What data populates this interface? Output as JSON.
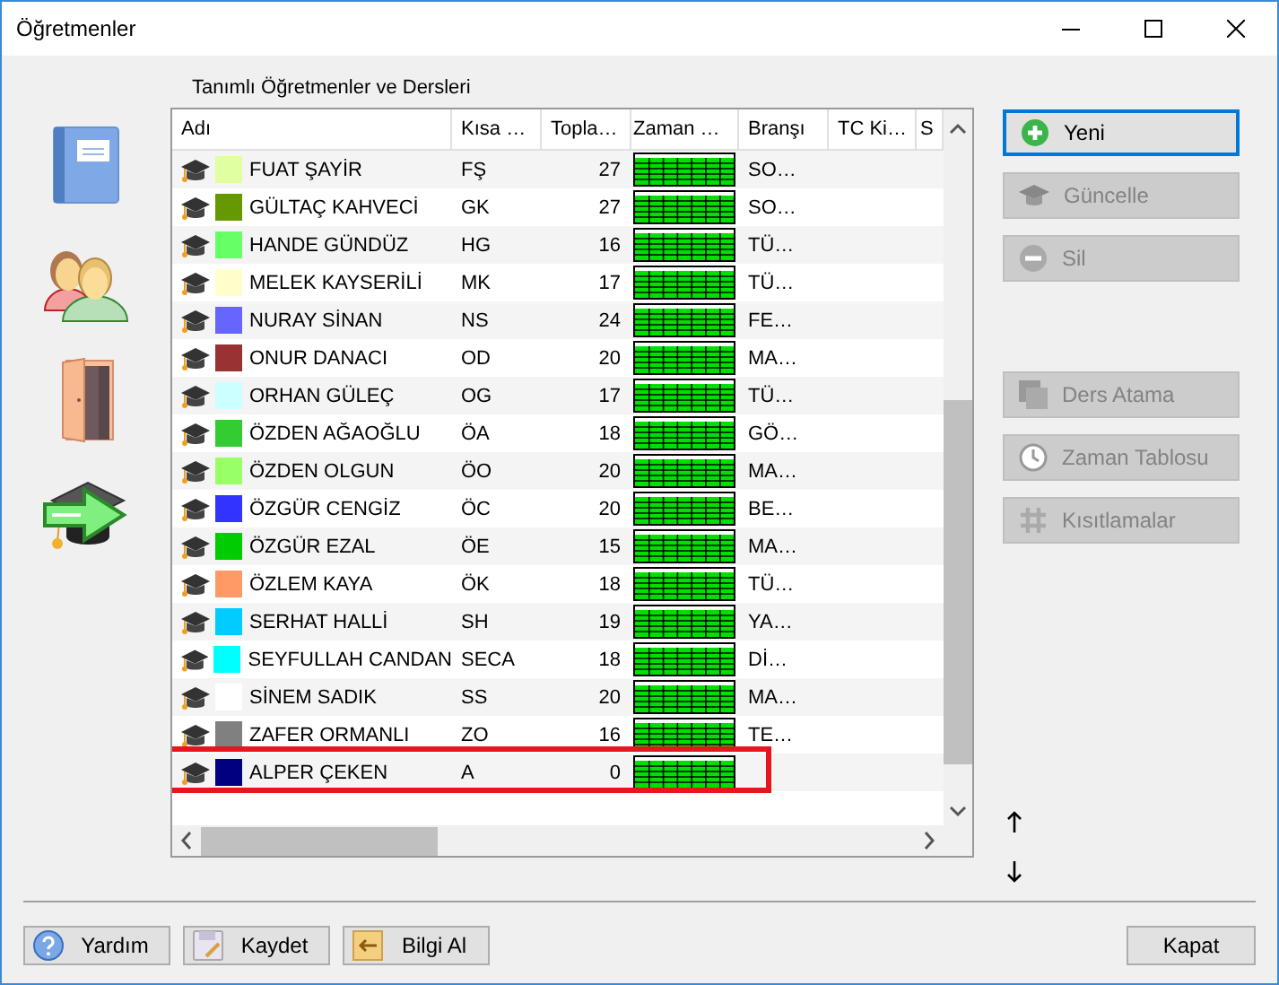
{
  "window": {
    "title": "Öğretmenler"
  },
  "group_label": "Tanımlı Öğretmenler ve Dersleri",
  "table": {
    "columns": [
      "Adı",
      "Kısa …",
      "Topla…",
      "Zaman …",
      "Branşı",
      "TC Ki…",
      "S"
    ],
    "rows": [
      {
        "name": "FUAT ŞAYİR",
        "short": "FŞ",
        "total": "27",
        "branch": "SO…",
        "color": "#e0ffa0",
        "highlighted": false
      },
      {
        "name": "GÜLTAÇ KAHVECİ",
        "short": "GK",
        "total": "27",
        "branch": "SO…",
        "color": "#669900",
        "highlighted": false
      },
      {
        "name": "HANDE GÜNDÜZ",
        "short": "HG",
        "total": "16",
        "branch": "TÜ…",
        "color": "#66ff66",
        "highlighted": false
      },
      {
        "name": "MELEK KAYSERİLİ",
        "short": "MK",
        "total": "17",
        "branch": "TÜ…",
        "color": "#ffffcc",
        "highlighted": false
      },
      {
        "name": "NURAY SİNAN",
        "short": "NS",
        "total": "24",
        "branch": "FE…",
        "color": "#6666ff",
        "highlighted": false
      },
      {
        "name": "ONUR DANACI",
        "short": "OD",
        "total": "20",
        "branch": "MA…",
        "color": "#993333",
        "highlighted": false
      },
      {
        "name": "ORHAN GÜLEÇ",
        "short": "OG",
        "total": "17",
        "branch": "TÜ…",
        "color": "#ccffff",
        "highlighted": false
      },
      {
        "name": "ÖZDEN AĞAOĞLU",
        "short": "ÖA",
        "total": "18",
        "branch": "GÖ…",
        "color": "#33cc33",
        "highlighted": false
      },
      {
        "name": "ÖZDEN OLGUN",
        "short": "ÖO",
        "total": "20",
        "branch": "MA…",
        "color": "#99ff66",
        "highlighted": false
      },
      {
        "name": "ÖZGÜR CENGİZ",
        "short": "ÖC",
        "total": "20",
        "branch": "BE…",
        "color": "#3333ff",
        "highlighted": false
      },
      {
        "name": "ÖZGÜR EZAL",
        "short": "ÖE",
        "total": "15",
        "branch": "MA…",
        "color": "#00cc00",
        "highlighted": false
      },
      {
        "name": "ÖZLEM KAYA",
        "short": "ÖK",
        "total": "18",
        "branch": "TÜ…",
        "color": "#ff9966",
        "highlighted": false
      },
      {
        "name": "SERHAT HALLİ",
        "short": "SH",
        "total": "19",
        "branch": "YA…",
        "color": "#00ccff",
        "highlighted": false
      },
      {
        "name": "SEYFULLAH CANDAN",
        "short": "SECA",
        "total": "18",
        "branch": "Dİ…",
        "color": "#00ffff",
        "highlighted": false
      },
      {
        "name": "SİNEM SADIK",
        "short": "SS",
        "total": "20",
        "branch": "MA…",
        "color": "#ffffff",
        "highlighted": false
      },
      {
        "name": "ZAFER ORMANLI",
        "short": "ZO",
        "total": "16",
        "branch": "TE…",
        "color": "#808080",
        "highlighted": false
      },
      {
        "name": "ALPER ÇEKEN",
        "short": "A",
        "total": "0",
        "color": "#000080",
        "highlighted": true
      }
    ]
  },
  "side_buttons": [
    {
      "label": "Yeni",
      "kind": "add",
      "disabled": false,
      "focused": true
    },
    {
      "label": "Güncelle",
      "kind": "cap",
      "disabled": true,
      "focused": false
    },
    {
      "label": "Sil",
      "kind": "remove",
      "disabled": true,
      "focused": false
    },
    {
      "label": "Ders Atama",
      "kind": "squares",
      "disabled": true,
      "focused": false
    },
    {
      "label": "Zaman Tablosu",
      "kind": "clock",
      "disabled": true,
      "focused": false
    },
    {
      "label": "Kısıtlamalar",
      "kind": "hash",
      "disabled": true,
      "focused": false
    }
  ],
  "bottom_buttons": [
    {
      "label": "Yardım",
      "kind": "help"
    },
    {
      "label": "Kaydet",
      "kind": "save"
    },
    {
      "label": "Bilgi Al",
      "kind": "import"
    }
  ],
  "close_button": "Kapat"
}
